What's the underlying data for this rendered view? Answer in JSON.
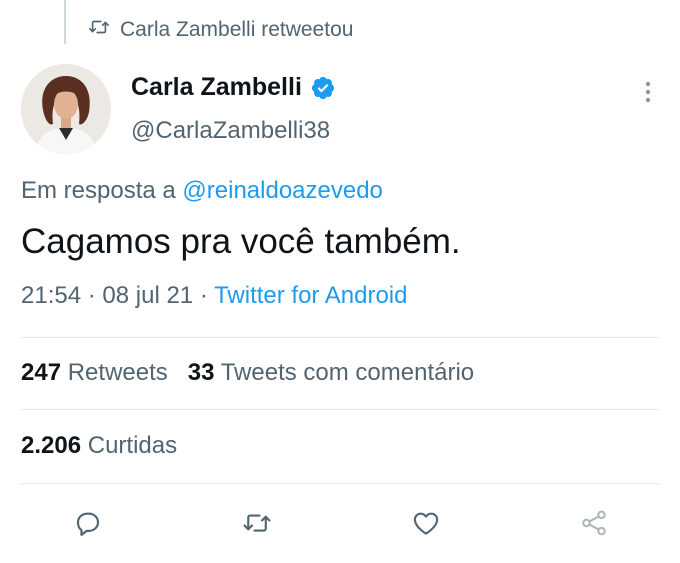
{
  "retweet_context": {
    "text": "Carla Zambelli retweetou"
  },
  "author": {
    "name": "Carla Zambelli",
    "handle": "@CarlaZambelli38",
    "verified": true
  },
  "reply": {
    "prefix": "Em resposta a",
    "mention": "@reinaldoazevedo"
  },
  "tweet": {
    "text": "Cagamos pra você também.",
    "time": "21:54",
    "separator1": "·",
    "date": "08 jul 21",
    "separator2": "·",
    "source": "Twitter for Android"
  },
  "stats": {
    "retweets_count": "247",
    "retweets_label": "Retweets",
    "quotes_count": "33",
    "quotes_label": "Tweets com comentário",
    "likes_count": "2.206",
    "likes_label": "Curtidas"
  },
  "icons": {
    "retweet_context": "retweet-icon",
    "verified": "verified-badge-icon",
    "more": "more-vertical-icon",
    "reply": "reply-icon",
    "retweet": "retweet-icon",
    "like": "heart-icon",
    "share": "share-icon"
  },
  "colors": {
    "accent": "#1d9bf0",
    "secondary_text": "#536471",
    "primary_text": "#0f1419",
    "divider": "#e1e8ed"
  }
}
